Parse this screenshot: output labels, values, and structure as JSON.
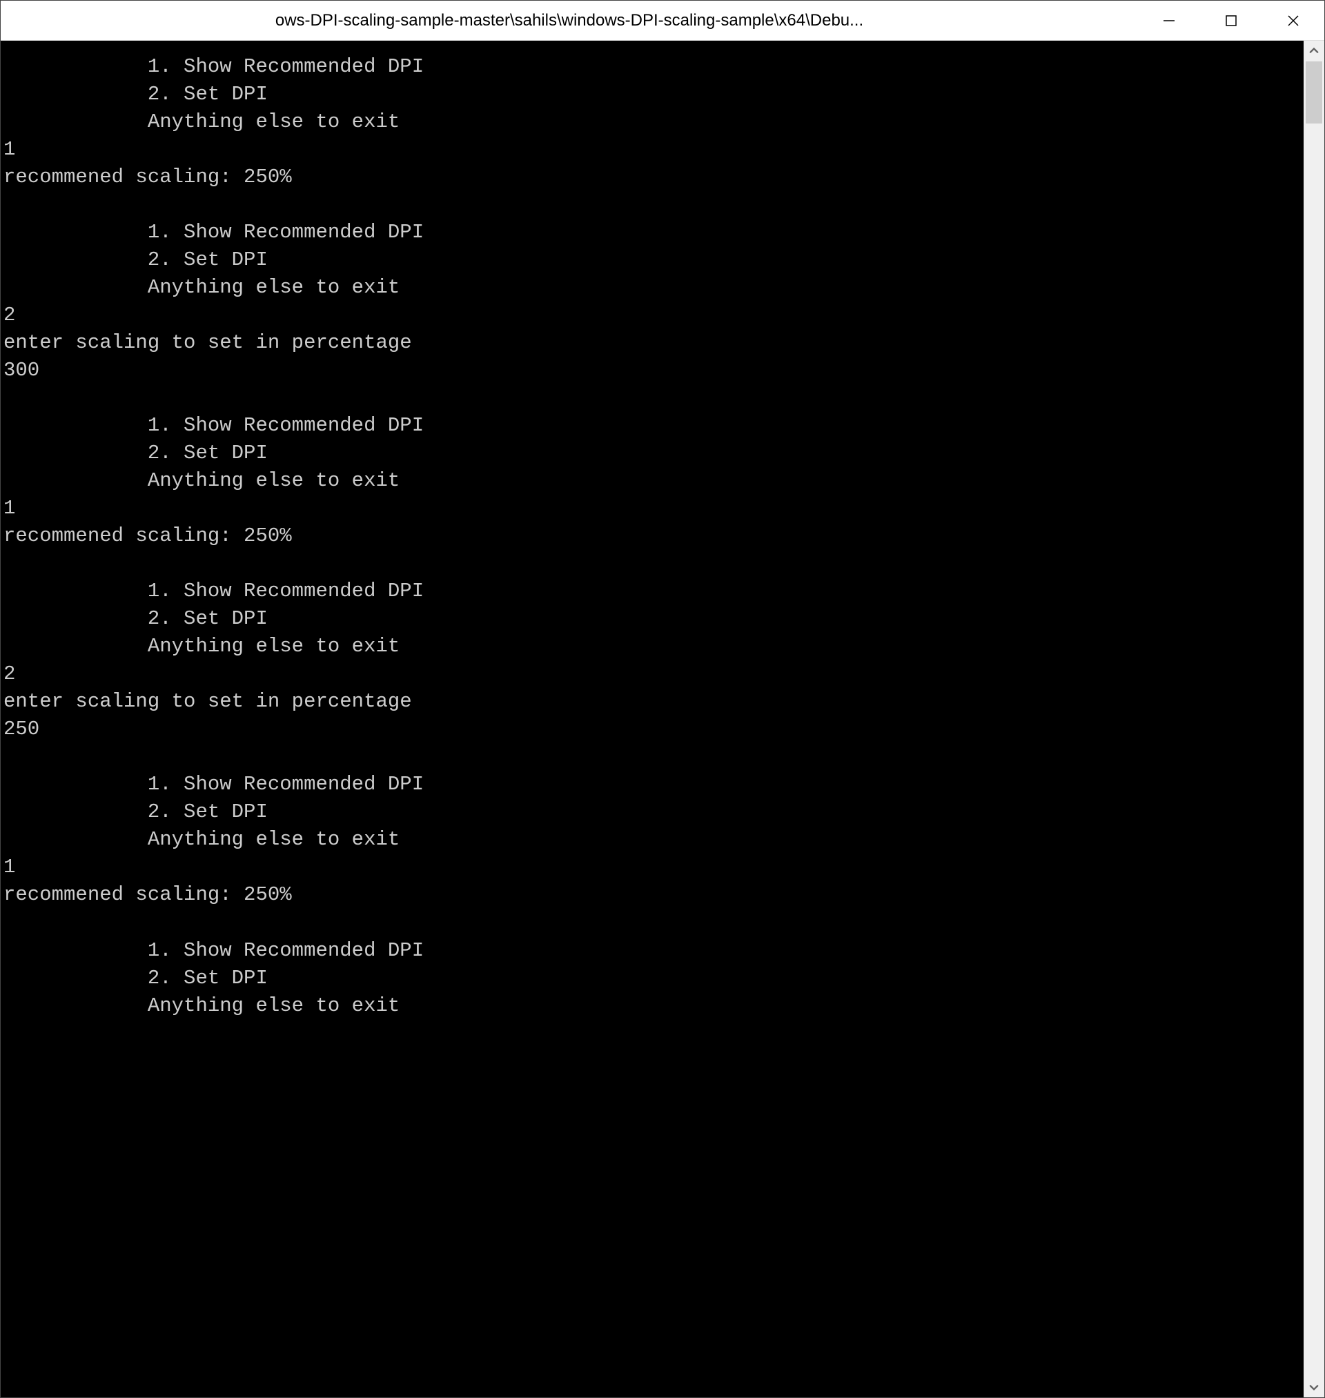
{
  "window": {
    "title": "ows-DPI-scaling-sample-master\\sahils\\windows-DPI-scaling-sample\\x64\\Debu..."
  },
  "menu": {
    "opt1": "            1. Show Recommended DPI",
    "opt2": "            2. Set DPI",
    "opt3": "            Anything else to exit"
  },
  "outputs": {
    "input1_a": "1",
    "recommended_a": "recommened scaling: 250%",
    "input2_a": "2",
    "enter_scaling_a": "enter scaling to set in percentage",
    "value300": "300",
    "input1_b": "1",
    "recommended_b": "recommened scaling: 250%",
    "input2_b": "2",
    "enter_scaling_b": "enter scaling to set in percentage",
    "value250": "250",
    "input1_c": "1",
    "recommended_c": "recommened scaling: 250%"
  }
}
